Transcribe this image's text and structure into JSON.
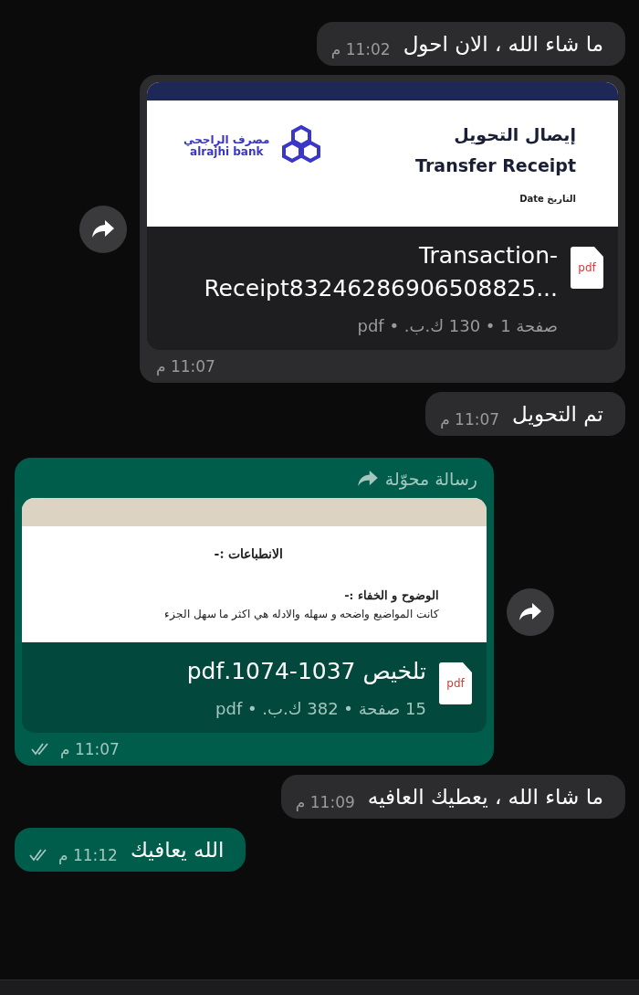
{
  "messages": [
    {
      "kind": "text",
      "outgoing": false,
      "text": "ما شاء الله ، الان احول",
      "time": "11:02 م"
    },
    {
      "kind": "document",
      "outgoing": false,
      "share_button": true,
      "preview": {
        "kind": "receipt",
        "title_ar": "إيصال التحويل",
        "title_en": "Transfer Receipt",
        "bank_ar": "مصرف الراجحي",
        "bank_en": "alrajhi bank",
        "date_label": "التاريخ Date"
      },
      "file_name": "Transaction-Receipt83246286906508825...",
      "meta": "صفحة 1 • 130 ك.ب. • pdf",
      "file_type": "pdf",
      "time": "11:07 م"
    },
    {
      "kind": "text",
      "outgoing": false,
      "text": "تم التحويل",
      "time": "11:07 م"
    },
    {
      "kind": "document",
      "outgoing": true,
      "share_button": true,
      "forwarded_label": "رسالة محوّلة",
      "read": true,
      "preview": {
        "kind": "notes",
        "heading": "الانطباعات :-",
        "subheading": "الوضوح و الخفاء :-",
        "line": "كانت المواضيع واضحه و سهله والادله هي اكثر ما سهل الجزء"
      },
      "file_name": "تلخيص 1037-1074.pdf",
      "meta": "15 صفحة • 382 ك.ب. • pdf",
      "file_type": "pdf",
      "time": "11:07 م"
    },
    {
      "kind": "text",
      "outgoing": false,
      "text": "ما شاء الله ، يعطيك العافيه",
      "time": "11:09 م"
    },
    {
      "kind": "text",
      "outgoing": true,
      "read": true,
      "text": "الله يعافيك",
      "time": "11:12 م"
    }
  ]
}
